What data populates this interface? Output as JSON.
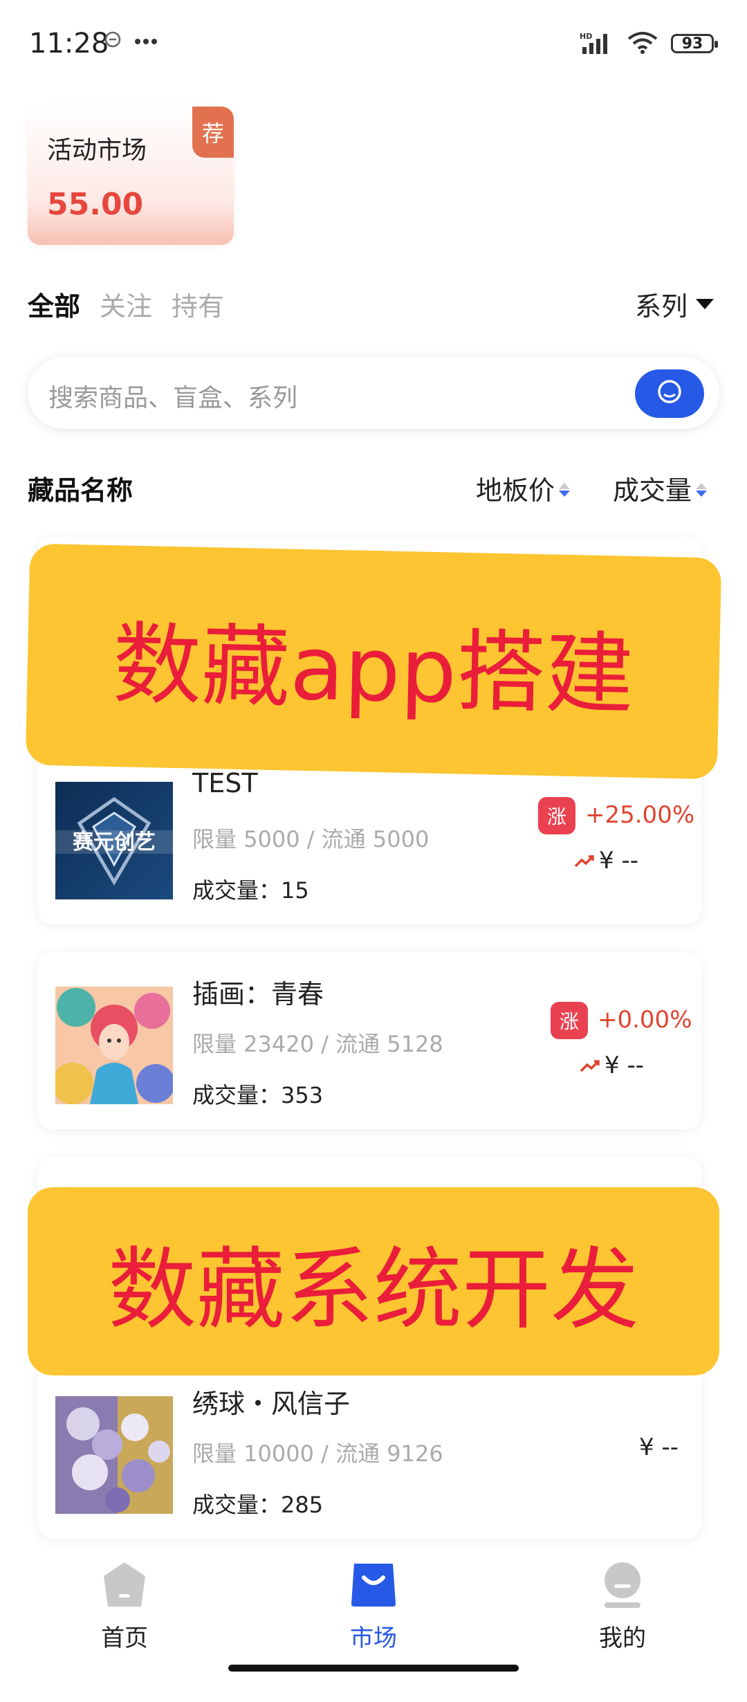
{
  "status_bar": {
    "time": "11:28",
    "battery": "93",
    "network": "HD"
  },
  "activity_card": {
    "title": "活动市场",
    "value": "55.00",
    "badge": "荐"
  },
  "tabs": [
    {
      "label": "全部",
      "active": true
    },
    {
      "label": "关注",
      "active": false
    },
    {
      "label": "持有",
      "active": false
    }
  ],
  "series_filter": {
    "label": "系列"
  },
  "search": {
    "placeholder": "搜索商品、盲盒、系列"
  },
  "columns": {
    "name": "藏品名称",
    "floor_price": "地板价",
    "volume": "成交量"
  },
  "items": [
    {
      "name": "TEST",
      "supply": "限量 5000 / 流通 5000",
      "volume": "成交量：15",
      "badge": "涨",
      "change": "+25.00%",
      "price": "¥ --",
      "thumb_text": "赛元创艺"
    },
    {
      "name": "插画：青春",
      "supply": "限量 23420 / 流通 5128",
      "volume": "成交量：353",
      "badge": "涨",
      "change": "+0.00%",
      "price": "¥ --"
    },
    {
      "name": "绣球・风信子",
      "supply": "限量 10000 / 流通 9126",
      "volume": "成交量：285",
      "price": "¥ --"
    }
  ],
  "banners": {
    "top": "数藏app搭建",
    "bottom": "数藏系统开发"
  },
  "nav": [
    {
      "label": "首页",
      "icon": "home-icon",
      "active": false
    },
    {
      "label": "市场",
      "icon": "market-bag-icon",
      "active": true
    },
    {
      "label": "我的",
      "icon": "profile-icon",
      "active": false
    }
  ],
  "colors": {
    "accent_blue": "#2659e6",
    "rise_red": "#ea4150",
    "banner_yellow": "#fcc531",
    "banner_text": "#ea1e3a"
  }
}
